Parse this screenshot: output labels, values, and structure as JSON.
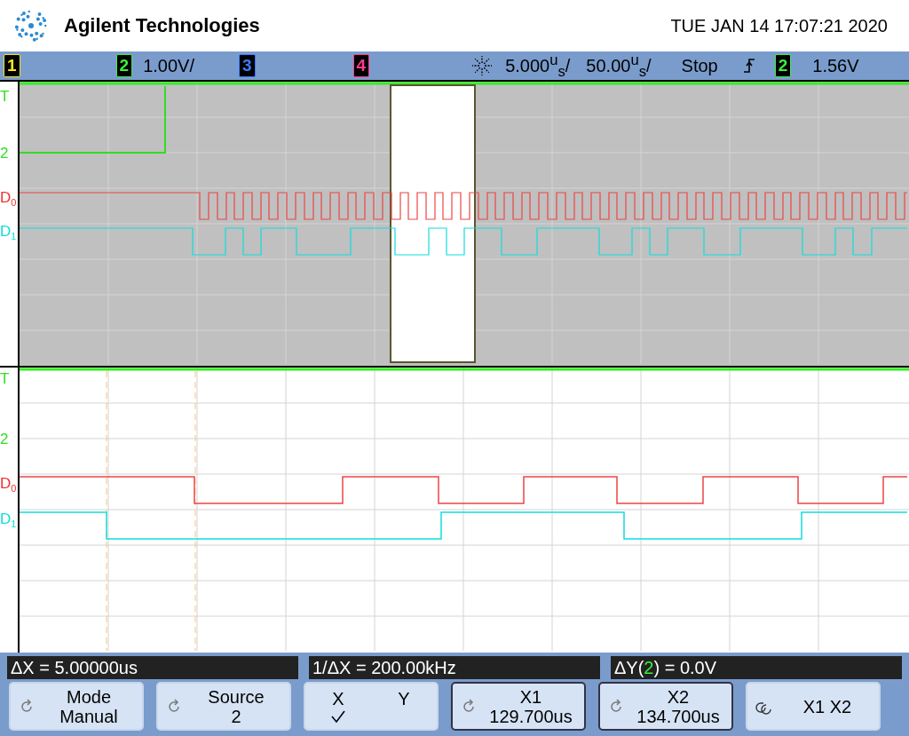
{
  "header": {
    "brand": "Agilent Technologies",
    "datetime": "TUE JAN 14 17:07:21 2020"
  },
  "status_bar": {
    "channels": [
      {
        "label": "1",
        "color": "#f5e61c"
      },
      {
        "label": "2",
        "color": "#3cf03c",
        "scale": "1.00V/"
      },
      {
        "label": "3",
        "color": "#3c7cff"
      },
      {
        "label": "4",
        "color": "#ff3c8c"
      }
    ],
    "timebase": "5.000$^{u}$$_{s}$/",
    "delay": "50.00$^{u}$$_{s}$/",
    "run_state": "Stop",
    "trigger_channel": "2",
    "trigger_level": "1.56V"
  },
  "trace_labels": [
    [
      {
        "text": "T",
        "color": "#33dd22"
      },
      {
        "text": "2",
        "color": "#33dd22"
      },
      {
        "text": "D$_{0}$",
        "color": "#ee3333"
      },
      {
        "text": "D$_{1}$",
        "color": "#11dddd"
      }
    ],
    [
      {
        "text": "T",
        "color": "#33dd22"
      },
      {
        "text": "2",
        "color": "#33dd22"
      },
      {
        "text": "D$_{0}$",
        "color": "#ee3333"
      },
      {
        "text": "D$_{1}$",
        "color": "#11dddd"
      }
    ]
  ],
  "readouts": [
    {
      "before": "ΔX = 5.00000us"
    },
    {
      "before": "1/ΔX = 200.00kHz"
    },
    {
      "before": "ΔY(",
      "channel": "2",
      "after": ") = 0.0V"
    }
  ],
  "softkeys": [
    {
      "kind": "knob",
      "title": "Mode",
      "value": "Manual",
      "active": false
    },
    {
      "kind": "knob",
      "title": "Source",
      "value": "2",
      "active": false
    },
    {
      "kind": "choice",
      "options": [
        {
          "label": "X",
          "selected": true
        },
        {
          "label": "Y",
          "selected": false
        }
      ],
      "active": false
    },
    {
      "kind": "knob",
      "title": "X1",
      "value": "129.700us",
      "active": true
    },
    {
      "kind": "knob",
      "title": "X2",
      "value": "134.700us",
      "active": true
    },
    {
      "kind": "pair",
      "title": "X1 X2",
      "active": false
    }
  ]
}
